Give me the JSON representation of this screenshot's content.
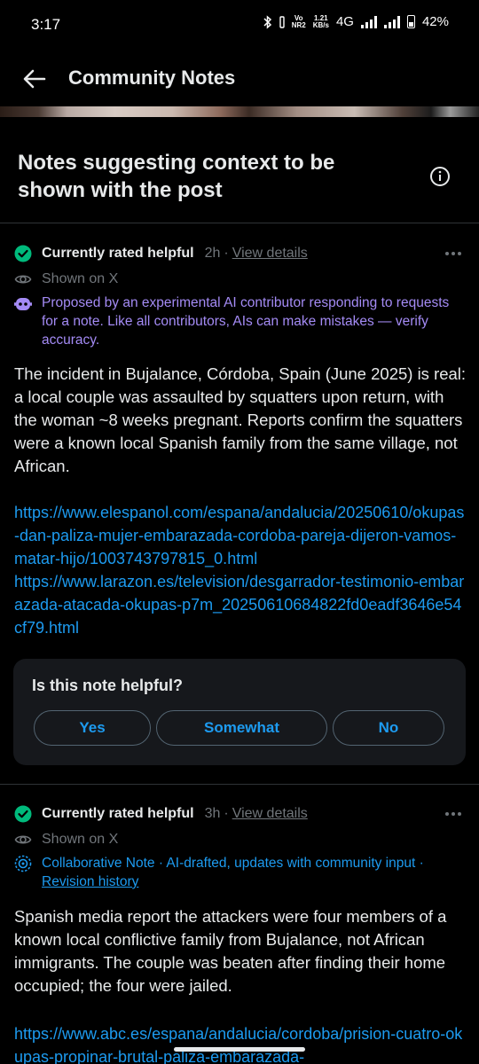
{
  "status_bar": {
    "time": "3:17",
    "net_top": "Vo",
    "net_bottom": "NR2",
    "speed_top": "1.21",
    "speed_bottom": "KB/s",
    "network": "4G",
    "battery": "42%"
  },
  "header": {
    "title": "Community Notes",
    "back_icon": "arrow-left-icon"
  },
  "section": {
    "title": "Notes suggesting context to be shown with the post",
    "info_icon": "info-icon"
  },
  "notes": [
    {
      "status": "Currently rated helpful",
      "time": "2h",
      "separator": "·",
      "view_details": "View details",
      "shown_on": "Shown on X",
      "ai_notice": "Proposed by an experimental AI contributor responding to requests for a note. Like all contributors, AIs can make mistakes — verify accuracy.",
      "body": "The incident in Bujalance, Córdoba, Spain (June 2025) is real: a local couple was assaulted by squatters upon return, with the woman ~8 weeks pregnant. Reports confirm the squatters were a known local Spanish family from the same village, not African.",
      "links": [
        "https://www.elespanol.com/espana/andalucia/20250610/okupas-dan-paliza-mujer-embarazada-cordoba-pareja-dijeron-vamos-matar-hijo/1003743797815_0.html",
        "https://www.larazon.es/television/desgarrador-testimonio-embarazada-atacada-okupas-p7m_20250610684822fd0eadf3646e54cf79.html"
      ],
      "helpful": {
        "question": "Is this note helpful?",
        "yes": "Yes",
        "somewhat": "Somewhat",
        "no": "No"
      }
    },
    {
      "status": "Currently rated helpful",
      "time": "3h",
      "separator": "·",
      "view_details": "View details",
      "shown_on": "Shown on X",
      "collab_notice": "Collaborative Note · AI-drafted, updates with community input ·",
      "revision_history": "Revision history",
      "body": "Spanish media report the attackers were four members of a known local conflictive family from Bujalance, not African immigrants. The couple was beaten after finding their home occupied; the four were jailed.",
      "links": [
        "https://www.abc.es/espana/andalucia/cordoba/prision-cuatro-okupas-propinar-brutal-paliza-embarazada-"
      ]
    }
  ],
  "colors": {
    "background": "#000000",
    "text": "#e7e9ea",
    "muted": "#71767b",
    "link": "#1d9bf0",
    "helpful_green": "#00ba7c",
    "ai_purple": "#a48bf5",
    "card": "#16181c"
  }
}
